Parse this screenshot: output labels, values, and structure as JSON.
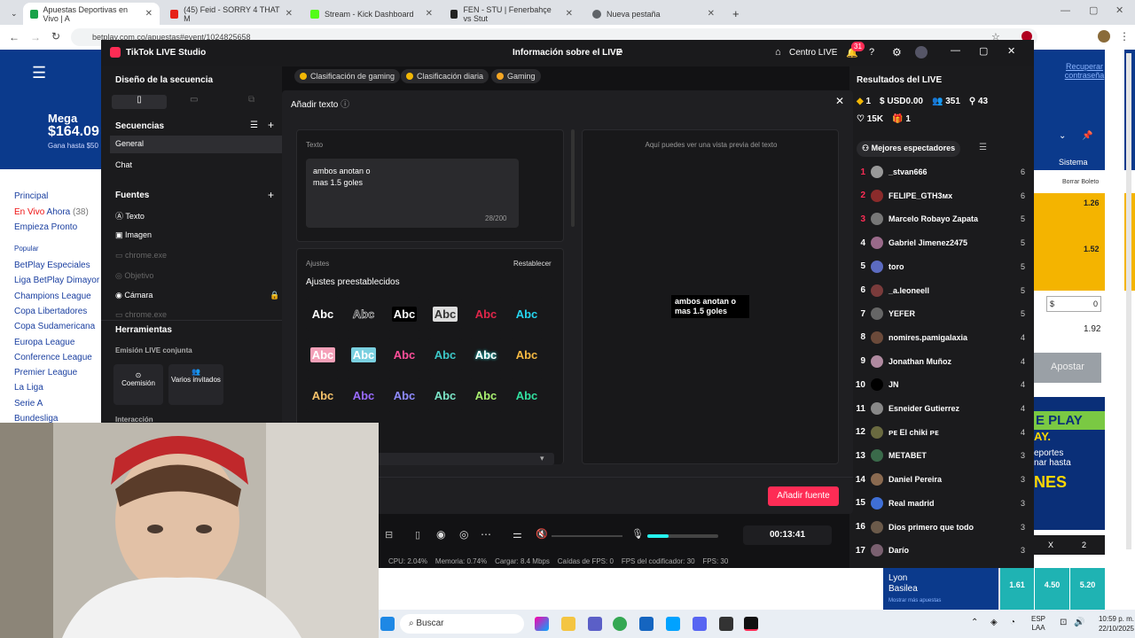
{
  "browser": {
    "tabs": [
      {
        "label": "Apuestas Deportivas en Vivo | A",
        "color": "#1aa34a"
      },
      {
        "label": "(45) Feid - SORRY 4 THAT M",
        "color": "#e62117"
      },
      {
        "label": "Stream - Kick Dashboard",
        "color": "#53fc18"
      },
      {
        "label": "FEN - STU | Fenerbahçe vs Stut",
        "color": "#222222"
      },
      {
        "label": "Nueva pestaña",
        "color": "#5f6368"
      }
    ],
    "url": "betplay.com.co/apuestas#event/1024825658"
  },
  "site": {
    "mega_label": "Mega",
    "mega_amount": "$164.09",
    "mega_sub": "Gana hasta $50",
    "nav": [
      "Principal",
      "En Vivo",
      "Ahora",
      "(38)",
      "Empieza Pronto"
    ],
    "popular_label": "Popular",
    "leagues": [
      "BetPlay Especiales",
      "Liga BetPlay Dimayor",
      "Champions League",
      "Copa Libertadores",
      "Copa Sudamericana",
      "Europa League",
      "Conference League",
      "Premier League",
      "La Liga",
      "Serie A",
      "Bundesliga"
    ],
    "recover": "Recuperar contraseña",
    "sistema": "Sistema",
    "borrar": "Borrar Boleto",
    "odds_a": "1.26",
    "odds_b": "1.52",
    "stake_currency": "$",
    "stake_value": "0",
    "total": "1.92",
    "apostar": "Apostar",
    "promo_a": "E PLAY",
    "promo_b": "AY.",
    "promo_c": "eportes",
    "promo_d": "nar hasta",
    "promo_e": "NES",
    "col_x": "X",
    "col_2": "2",
    "match_team_a": "Lyon",
    "match_team_b": "Basilea",
    "match_more": "Mostrar más apuestas",
    "odds_row": [
      "1.61",
      "4.50",
      "5.20"
    ]
  },
  "tiktok": {
    "app_title": "TikTok LIVE Studio",
    "center_title": "Información sobre el LIVE",
    "centro_live": "Centro LIVE",
    "notif_count": "31",
    "chips": [
      "Clasificación de gaming",
      "Clasificación diaria",
      "Gaming"
    ],
    "left": {
      "design_title": "Diseño de la secuencia",
      "sequences_title": "Secuencias",
      "sequences": [
        "General",
        "Chat"
      ],
      "sources_title": "Fuentes",
      "sources": [
        "Texto",
        "Imagen",
        "chrome.exe",
        "Objetivo",
        "Cámara",
        "chrome.exe"
      ],
      "tools_title": "Herramientas",
      "joint_title": "Emisión LIVE conjunta",
      "cohost": "Coemisión",
      "guests": "Varios invitados",
      "interaction": "Interacción"
    },
    "right": {
      "results_title": "Resultados del LIVE",
      "stat_diamonds": "1",
      "stat_usd": "USD0.00",
      "stat_viewers": "351",
      "stat_followers": "43",
      "stat_likes": "15K",
      "stat_gifts": "1",
      "top_viewers_tab": "Mejores espectadores",
      "viewers": [
        {
          "rank": "1",
          "name": "_stvan666",
          "score": "6"
        },
        {
          "rank": "2",
          "name": "FELIPE_GTH3ᴍx",
          "score": "6"
        },
        {
          "rank": "3",
          "name": "Marcelo Robayo Zapata",
          "score": "5"
        },
        {
          "rank": "4",
          "name": "Gabriel Jimenez2475",
          "score": "5"
        },
        {
          "rank": "5",
          "name": "toro",
          "score": "5"
        },
        {
          "rank": "6",
          "name": "_a.leoneell",
          "score": "5"
        },
        {
          "rank": "7",
          "name": "YEFER",
          "score": "5"
        },
        {
          "rank": "8",
          "name": "nomires.pamigalaxia",
          "score": "4"
        },
        {
          "rank": "9",
          "name": "Jonathan Muñoz",
          "score": "4"
        },
        {
          "rank": "10",
          "name": "JN",
          "score": "4"
        },
        {
          "rank": "11",
          "name": "Esneider Gutierrez",
          "score": "4"
        },
        {
          "rank": "12",
          "name": "ᴘᴇ El chiki ᴘᴇ",
          "score": "4"
        },
        {
          "rank": "13",
          "name": "METABET",
          "score": "3"
        },
        {
          "rank": "14",
          "name": "Daniel Pereira",
          "score": "3"
        },
        {
          "rank": "15",
          "name": "Real madrid",
          "score": "3"
        },
        {
          "rank": "16",
          "name": "Dios primero que todo",
          "score": "3"
        },
        {
          "rank": "17",
          "name": "Darío",
          "score": "3"
        }
      ]
    },
    "bottom": {
      "timer": "00:13:41",
      "cpu": "CPU: 2.04%",
      "memory": "Memoria: 0.74%",
      "load": "Cargar: 8.4 Mbps",
      "fps_drops": "Caídas de FPS: 0",
      "encoder_fps": "FPS del codificador: 30",
      "fps": "FPS: 30",
      "volume_level": 0.3
    },
    "modal": {
      "title": "Añadir texto",
      "text_label": "Texto",
      "text_value": "ambos anotan o\nmas 1.5 goles",
      "char_count": "28/200",
      "preview_hint": "Aquí puedes ver una vista previa del texto",
      "preview_line1": "ambos anotan o",
      "preview_line2": "mas 1.5 goles",
      "settings_label": "Ajustes",
      "reset": "Restablecer",
      "presets_title": "Ajustes preestablecidos",
      "preset_text": "Abc",
      "add_button": "Añadir fuente"
    }
  },
  "taskbar": {
    "search": "Buscar",
    "lang1": "ESP",
    "lang2": "LAA",
    "time": "10:59 p. m.",
    "date": "22/10/2025"
  },
  "colors": {
    "accent": "#fe2c55",
    "bg": "#121214"
  }
}
